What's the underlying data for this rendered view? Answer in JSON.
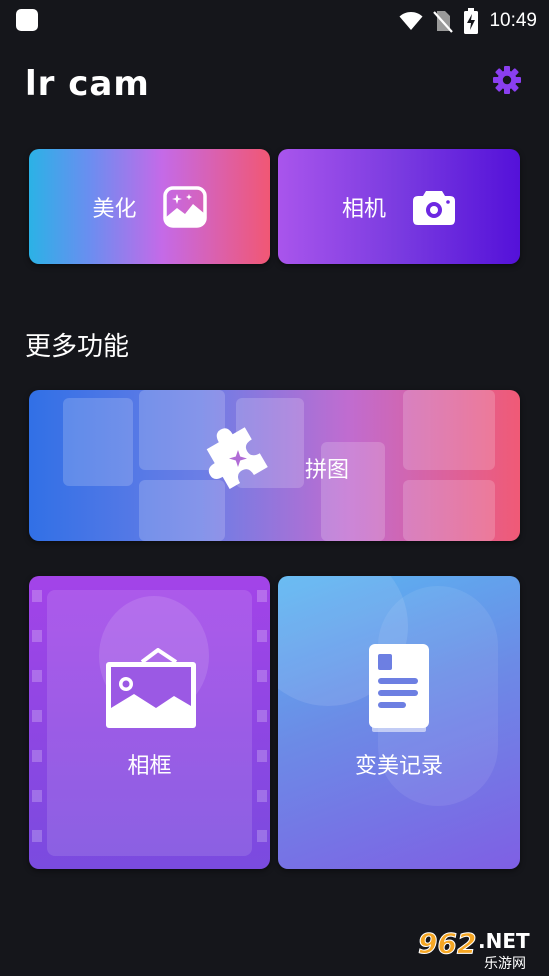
{
  "status_bar": {
    "time": "10:49",
    "icons": [
      "wifi-icon",
      "no-sim-icon",
      "battery-charging-icon"
    ]
  },
  "header": {
    "app_title": "lr cam",
    "settings_icon": "gear-icon",
    "accent_color": "#8a3ff0"
  },
  "top_actions": {
    "beautify_label": "美化",
    "beautify_icon": "sparkle-image-icon",
    "camera_label": "相机",
    "camera_icon": "camera-icon"
  },
  "more_section": {
    "title": "更多功能",
    "collage_label": "拼图",
    "collage_icon": "puzzle-icon",
    "frame_label": "相框",
    "frame_icon": "photo-frame-icon",
    "record_label": "变美记录",
    "record_icon": "document-icon"
  },
  "watermark": {
    "brand": "962",
    "suffix": ".NET",
    "subtitle": "乐游网"
  }
}
